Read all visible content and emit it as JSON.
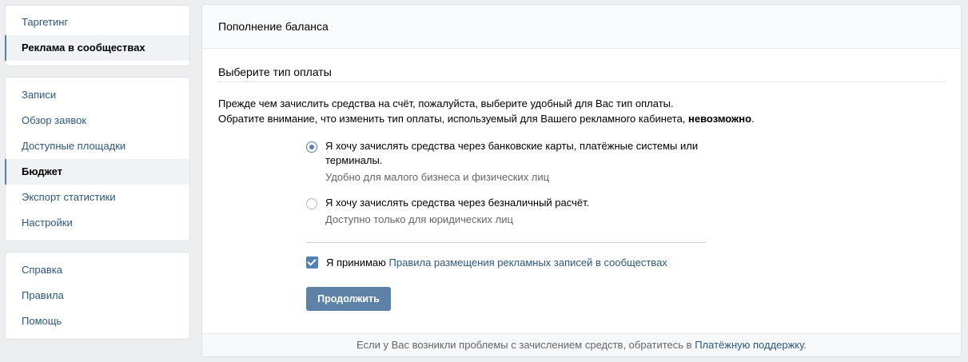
{
  "sidebar": {
    "block1": [
      {
        "label": "Таргетинг",
        "active": false
      },
      {
        "label": "Реклама в сообществах",
        "active": true
      }
    ],
    "block2": [
      {
        "label": "Записи",
        "active": false
      },
      {
        "label": "Обзор заявок",
        "active": false
      },
      {
        "label": "Доступные площадки",
        "active": false
      },
      {
        "label": "Бюджет",
        "active": true
      },
      {
        "label": "Экспорт статистики",
        "active": false
      },
      {
        "label": "Настройки",
        "active": false
      }
    ],
    "block3": [
      {
        "label": "Справка",
        "active": false
      },
      {
        "label": "Правила",
        "active": false
      },
      {
        "label": "Помощь",
        "active": false
      }
    ]
  },
  "main": {
    "title": "Пополнение баланса",
    "section_title": "Выберите тип оплаты",
    "desc_line1": "Прежде чем зачислить средства на счёт, пожалуйста, выберите удобный для Вас тип оплаты.",
    "desc_line2_prefix": "Обратите внимание, что изменить тип оплаты, используемый для Вашего рекламного кабинета, ",
    "desc_line2_bold": "невозможно",
    "desc_line2_suffix": ".",
    "options": [
      {
        "label": "Я хочу зачислять средства через банковские карты, платёжные системы или терминалы.",
        "sub": "Удобно для малого бизнеса и физических лиц",
        "selected": true
      },
      {
        "label": "Я хочу зачислять средства через безналичный расчёт.",
        "sub": "Доступно только для юридических лиц",
        "selected": false
      }
    ],
    "accept_prefix": "Я принимаю",
    "accept_link": "Правила размещения рекламных записей в сообществах",
    "accept_checked": true,
    "continue_label": "Продолжить",
    "footer_prefix": "Если у Вас возникли проблемы с зачислением средств, обратитесь в",
    "footer_link": "Платёжную поддержку",
    "footer_suffix": "."
  },
  "colors": {
    "accent": "#5181b8",
    "link": "#2a5885",
    "background": "#edeef0"
  }
}
